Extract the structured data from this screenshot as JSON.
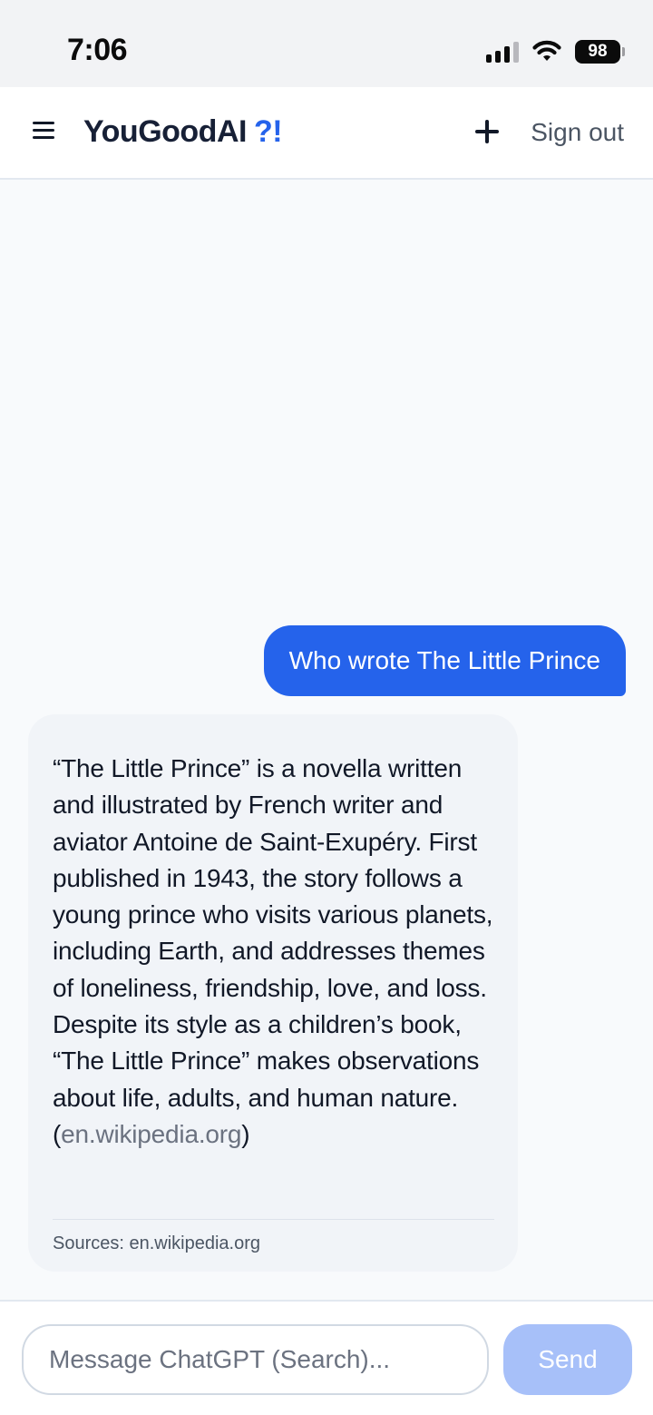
{
  "status_bar": {
    "time": "7:06",
    "battery": "98",
    "icons": [
      "cellular-signal-icon",
      "wifi-icon",
      "battery-icon"
    ]
  },
  "header": {
    "brand": "YouGoodAI",
    "brand_accent": "?!",
    "sign_out_label": "Sign out",
    "icons": [
      "menu-icon",
      "plus-icon"
    ]
  },
  "chat": {
    "user_message": "Who wrote The Little Prince",
    "assistant_message": {
      "text": "“The Little Prince” is a novella written and illustrated by French writer and aviator Antoine de Saint-Exupéry. First published in 1943, the story follows a young prince who visits various planets, including Earth, and addresses themes of loneliness, friendship, love, and loss. Despite its style as a children’s book, “The Little Prince” makes observations about life, adults, and human nature. (",
      "citation_link": "en.wikipedia.org",
      "text_end": ")",
      "sources": "Sources: en.wikipedia.org"
    }
  },
  "composer": {
    "placeholder": "Message ChatGPT (Search)...",
    "value": "",
    "send_label": "Send"
  },
  "colors": {
    "accent": "#2563eb",
    "send_disabled": "#a7c0f9",
    "bubble_bg": "#f1f4f8"
  }
}
